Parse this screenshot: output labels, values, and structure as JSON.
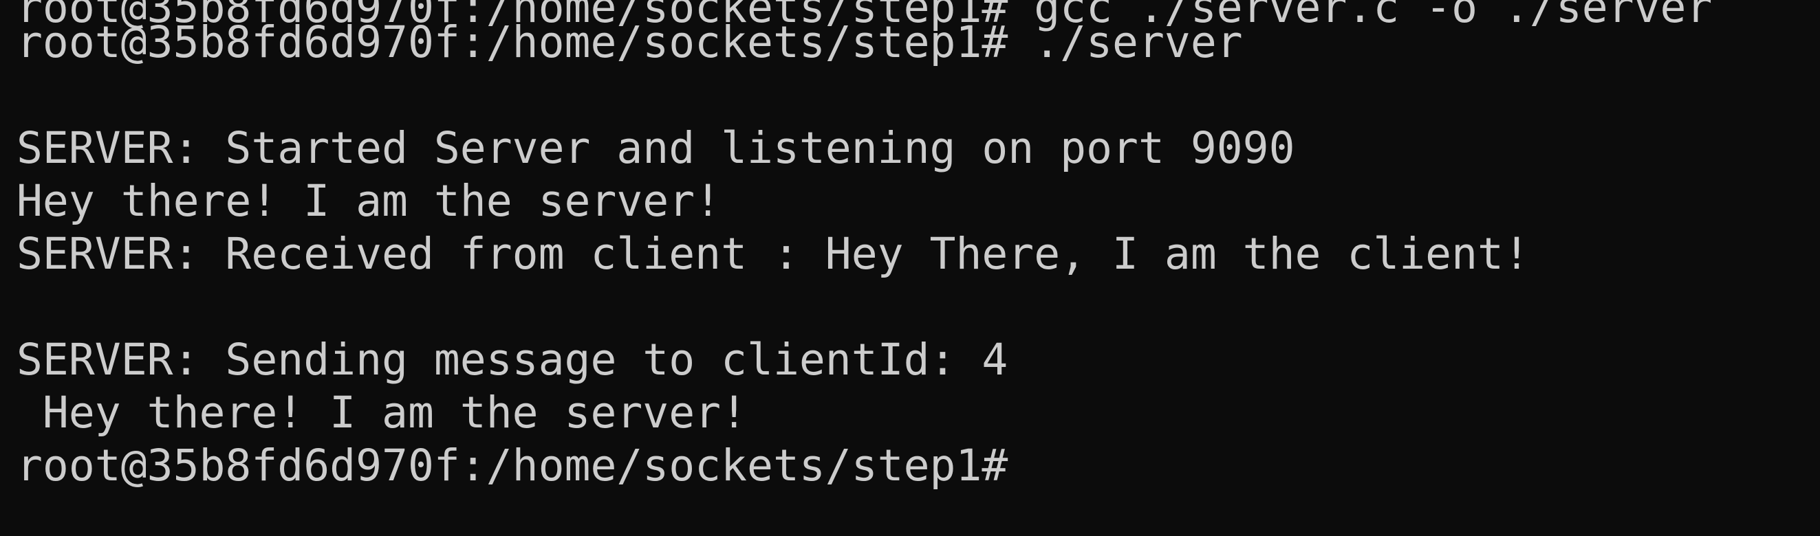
{
  "terminal": {
    "background": "#0c0c0c",
    "foreground": "#cccccc",
    "lines": [
      "root@35b8fd6d970f:/home/sockets/step1# gcc ./server.c -o ./server",
      "root@35b8fd6d970f:/home/sockets/step1# ./server",
      "",
      "SERVER: Started Server and listening on port 9090",
      "Hey there! I am the server!",
      "SERVER: Received from client : Hey There, I am the client!",
      "",
      "SERVER: Sending message to clientId: 4",
      " Hey there! I am the server!",
      "root@35b8fd6d970f:/home/sockets/step1# "
    ]
  }
}
